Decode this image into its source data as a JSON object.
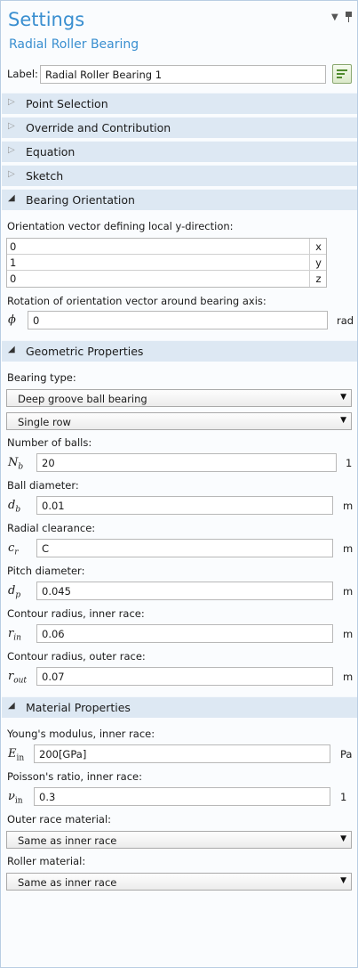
{
  "header": {
    "title": "Settings",
    "subtitle": "Radial Roller Bearing",
    "menu_arrow": "▼"
  },
  "label_row": {
    "label": "Label:",
    "value": "Radial Roller Bearing 1",
    "button_icon": "node-label-icon"
  },
  "sections": {
    "point_selection": "Point Selection",
    "override": "Override and Contribution",
    "equation": "Equation",
    "sketch": "Sketch",
    "bearing_orientation": "Bearing Orientation",
    "geometric": "Geometric Properties",
    "material": "Material Properties"
  },
  "orientation": {
    "vector_label": "Orientation vector defining local y-direction:",
    "rows": [
      {
        "value": "0",
        "component": "x"
      },
      {
        "value": "1",
        "component": "y"
      },
      {
        "value": "0",
        "component": "z"
      }
    ],
    "rotation_label": "Rotation of orientation vector around bearing axis:",
    "rotation_symbol": "ϕ",
    "rotation_value": "0",
    "rotation_unit": "rad"
  },
  "geometric": {
    "bearing_type_label": "Bearing type:",
    "bearing_type": "Deep groove ball bearing",
    "row_type": "Single row",
    "num_balls_label": "Number of balls:",
    "num_balls_sym": "N",
    "num_balls_sub": "b",
    "num_balls": "20",
    "num_balls_unit": "1",
    "ball_diam_label": "Ball diameter:",
    "ball_diam_sym": "d",
    "ball_diam_sub": "b",
    "ball_diam": "0.01",
    "ball_diam_unit": "m",
    "clearance_label": "Radial clearance:",
    "clearance_sym": "c",
    "clearance_sub": "r",
    "clearance": "C",
    "clearance_unit": "m",
    "pitch_label": "Pitch diameter:",
    "pitch_sym": "d",
    "pitch_sub": "p",
    "pitch": "0.045",
    "pitch_unit": "m",
    "inner_contour_label": "Contour radius, inner race:",
    "inner_contour_sym": "r",
    "inner_contour_sub": "in",
    "inner_contour": "0.06",
    "inner_contour_unit": "m",
    "outer_contour_label": "Contour radius, outer race:",
    "outer_contour_sym": "r",
    "outer_contour_sub": "out",
    "outer_contour": "0.07",
    "outer_contour_unit": "m"
  },
  "material": {
    "youngs_label": "Young's modulus, inner race:",
    "youngs_sym": "E",
    "youngs_sub": "in",
    "youngs": "200[GPa]",
    "youngs_unit": "Pa",
    "poisson_label": "Poisson's ratio, inner race:",
    "poisson_sym": "ν",
    "poisson_sub": "in",
    "poisson": "0.3",
    "poisson_unit": "1",
    "outer_race_label": "Outer race material:",
    "outer_race": "Same as inner race",
    "roller_label": "Roller material:",
    "roller": "Same as inner race"
  }
}
